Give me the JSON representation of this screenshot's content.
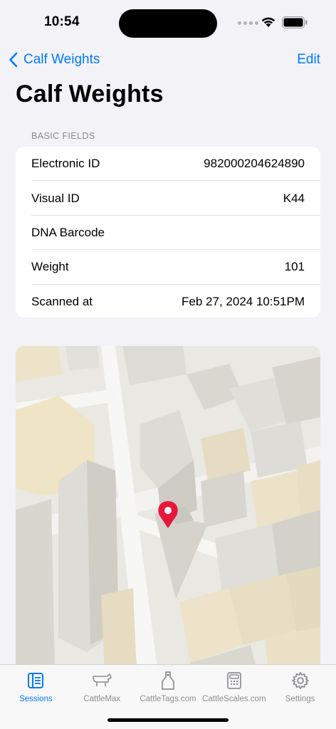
{
  "status_bar": {
    "time": "10:54"
  },
  "nav": {
    "back_label": "Calf Weights",
    "edit_label": "Edit",
    "title": "Calf Weights"
  },
  "section": {
    "header": "BASIC FIELDS",
    "rows": [
      {
        "label": "Electronic ID",
        "value": "982000204624890"
      },
      {
        "label": "Visual ID",
        "value": "K44"
      },
      {
        "label": "DNA Barcode",
        "value": ""
      },
      {
        "label": "Weight",
        "value": "101"
      },
      {
        "label": "Scanned at",
        "value": "Feb 27, 2024 10:51PM"
      }
    ]
  },
  "map": {
    "pin_icon": "map-pin-icon",
    "pin_color": "#e5183b"
  },
  "tab_bar": {
    "tabs": [
      {
        "label": "Sessions",
        "icon": "sessions-icon",
        "active": true
      },
      {
        "label": "CattleMax",
        "icon": "cattlemax-icon",
        "active": false
      },
      {
        "label": "CattleTags.com",
        "icon": "cattletags-icon",
        "active": false
      },
      {
        "label": "CattleScales.com",
        "icon": "cattlescales-icon",
        "active": false
      },
      {
        "label": "Settings",
        "icon": "gear-icon",
        "active": false
      }
    ]
  },
  "colors": {
    "accent": "#007aff",
    "background": "#f2f2f7",
    "inactive": "#8e8e93"
  }
}
